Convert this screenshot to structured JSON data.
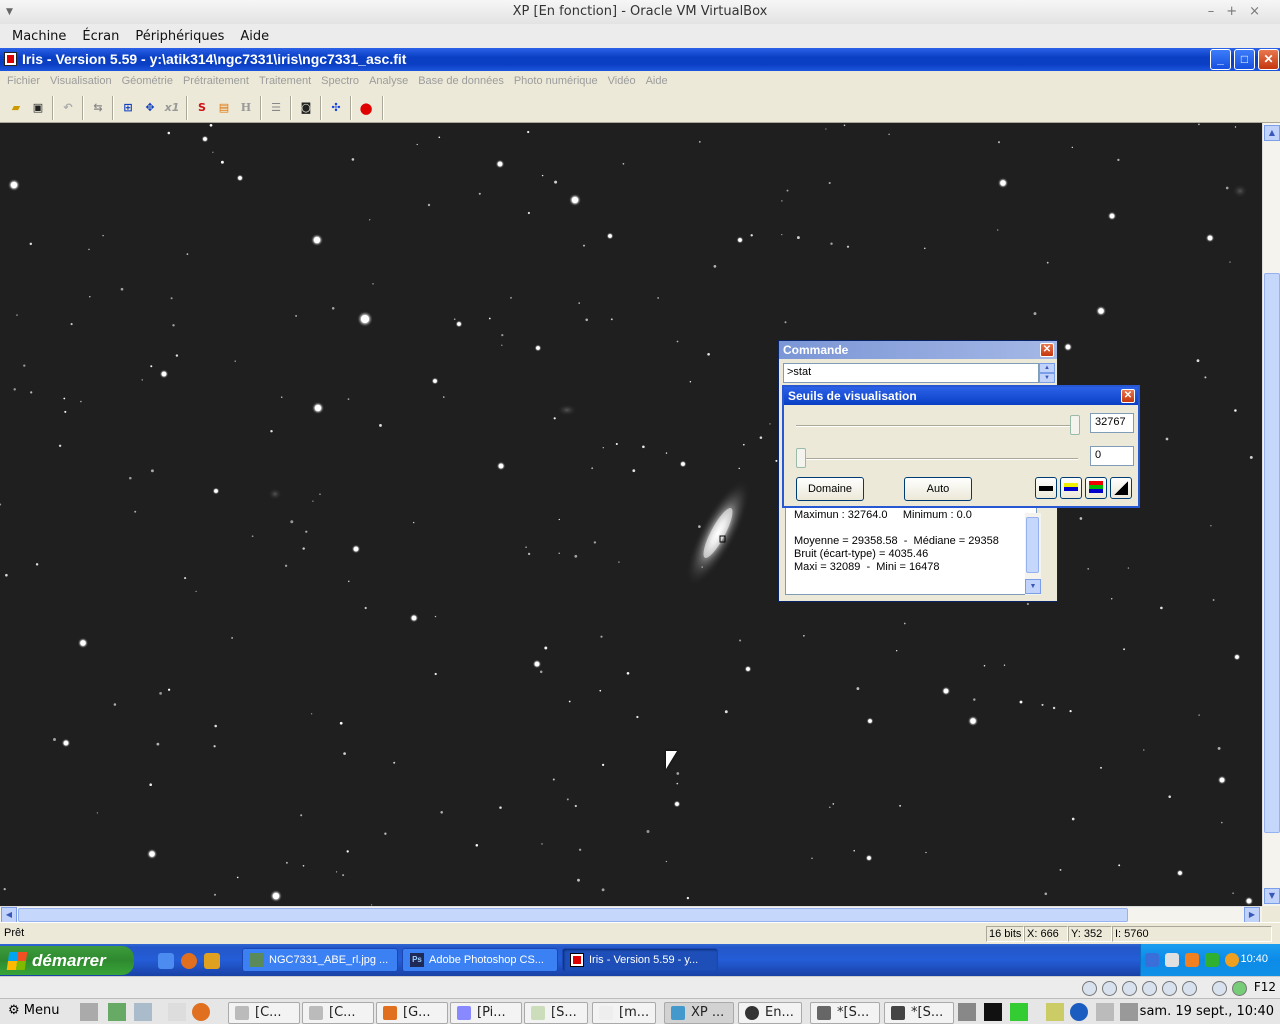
{
  "host": {
    "title": "XP [En fonction] - Oracle VM VirtualBox",
    "menu": [
      "Machine",
      "Écran",
      "Périphériques",
      "Aide"
    ]
  },
  "iris": {
    "title": "Iris - Version 5.59 - y:\\atik314\\ngc7331\\iris\\ngc7331_asc.fit",
    "menu": [
      "Fichier",
      "Visualisation",
      "Géométrie",
      "Prétraitement",
      "Traitement",
      "Spectro",
      "Analyse",
      "Base de données",
      "Photo numérique",
      "Vidéo",
      "Aide"
    ],
    "toolbar": [
      "open-icon",
      "save-icon",
      "undo-icon",
      "swap-icon",
      "zoom-in-icon",
      "move-icon",
      "x1-icon",
      "s-icon",
      "orange-box-icon",
      "h-icon",
      "list-icon",
      "camera-icon",
      "blue-cross-icon",
      "red-dot-icon"
    ],
    "status": {
      "text": "Prêt",
      "bits": "16 bits",
      "x": "X: 666",
      "y": "Y: 352",
      "i": "I: 5760"
    }
  },
  "commande": {
    "title": "Commande",
    "input": ">stat",
    "output": "Sigma : 306.2\nMaximun : 32764.0     Minimum : 0.0\n\nMoyenne = 29358.58  -  Médiane = 29358\nBruit (écart-type) = 4035.46\nMaxi = 32089  -  Mini = 16478"
  },
  "seuils": {
    "title": "Seuils de visualisation",
    "high": "32767",
    "low": "0",
    "domaine": "Domaine",
    "auto": "Auto"
  },
  "xp_taskbar": {
    "start": "démarrer",
    "tasks": [
      {
        "label": "NGC7331_ABE_rl.jpg ...",
        "icon": "image-icon"
      },
      {
        "label": "Adobe Photoshop CS...",
        "icon": "photoshop-icon"
      },
      {
        "label": "Iris - Version 5.59 - y...",
        "icon": "iris-icon"
      }
    ],
    "clock": "10:40"
  },
  "host_panel": {
    "menu": "Menu",
    "tasks": [
      "[C...",
      "[C...",
      "[G...",
      "[Pi...",
      "[S...",
      "[m...",
      "XP ...",
      "En...",
      "*[S...",
      "*[S..."
    ],
    "clock": "sam. 19 sept., 10:40",
    "f12": "F12"
  },
  "colors": {
    "xp_blue": "#0a3fc4",
    "xp_green": "#3c9a3c",
    "sky": "#1f1f1f"
  }
}
